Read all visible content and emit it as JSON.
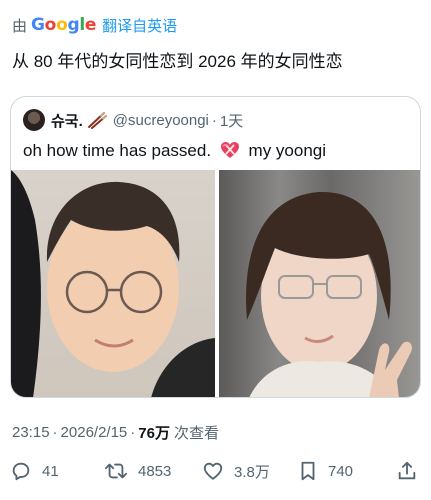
{
  "translation": {
    "by_label": "由",
    "google_letters": [
      "G",
      "o",
      "o",
      "g",
      "l",
      "e"
    ],
    "link_label": "翻译自英语"
  },
  "tweet": {
    "text": "从 80 年代的女同性恋到 2026 年的女同性恋"
  },
  "quote": {
    "author_name": "슈국.",
    "handle": "@sucreyoongi",
    "separator": "·",
    "time": "1天",
    "text_before": "oh how time has passed.",
    "text_after": "my yoongi"
  },
  "meta": {
    "time": "23:15",
    "separator": "·",
    "date": "2026/2/15",
    "views_count": "76万",
    "views_label": "次查看"
  },
  "actions": {
    "replies": "41",
    "reposts": "4853",
    "likes": "3.8万",
    "bookmarks": "740"
  },
  "colors": {
    "text_primary": "#0f1419",
    "text_secondary": "#536471",
    "link_blue": "#1d9bf0",
    "border": "#cfd9de"
  }
}
